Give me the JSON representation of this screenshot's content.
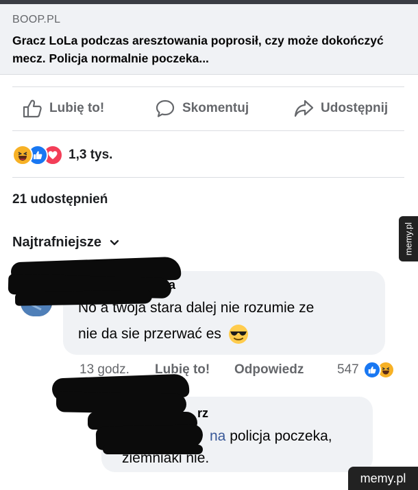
{
  "link": {
    "domain": "BOOP.PL",
    "title": "Gracz LoLa podczas aresztowania poprosił, czy może dokończyć mecz. Policja normalnie poczeka..."
  },
  "actions": {
    "like": "Lubię to!",
    "comment": "Skomentuj",
    "share": "Udostępnij"
  },
  "reactions": {
    "icons": [
      "laugh-emoji",
      "like-reaction",
      "love-reaction"
    ],
    "count": "1,3 tys."
  },
  "shares": "21 udostępnień",
  "sort": {
    "label": "Najtrafniejsze"
  },
  "comments": [
    {
      "author_visible": "a",
      "text_line1": "No a twoja stara dalej nie rozumie ze",
      "text_line2": "nie da sie przerwać es",
      "time": "13 godz.",
      "like": "Lubię to!",
      "reply": "Odpowiedz",
      "reaction_count": "547"
    },
    {
      "author_visible": "rz",
      "mention_visible": "na",
      "text_line1_rest": " policja poczeka,",
      "text_line2": "ziemniaki nie."
    }
  ],
  "watermarks": {
    "side": "memy.pl",
    "corner": "memy.pl"
  },
  "colors": {
    "muted": "#65676b",
    "bubble": "#f0f2f5",
    "link_blue": "#385898",
    "like_blue": "#1877f2",
    "love_red": "#f33e58",
    "haha_yellow": "#f7b125"
  }
}
